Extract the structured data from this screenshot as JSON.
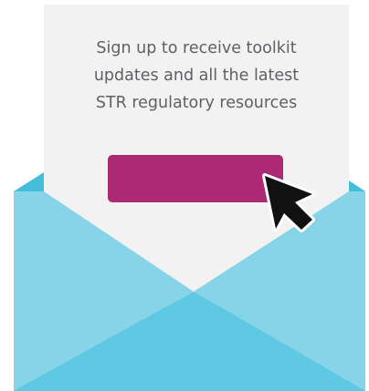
{
  "letter": {
    "lines": [
      "Sign up to receive toolkit",
      "updates and all the latest",
      "STR regulatory resources"
    ]
  },
  "signup_button": {
    "label": ""
  },
  "colors": {
    "letter_paper": "#f2f2f2",
    "text": "#5d6064",
    "button": "#ac2a73",
    "envelope_back": "#44bedb",
    "envelope_flap_light": "#87d4e8",
    "envelope_front": "#5fc8e2",
    "cursor": "#111111"
  },
  "icons": {
    "cursor": "mouse-pointer-icon",
    "envelope": "envelope-illustration"
  }
}
